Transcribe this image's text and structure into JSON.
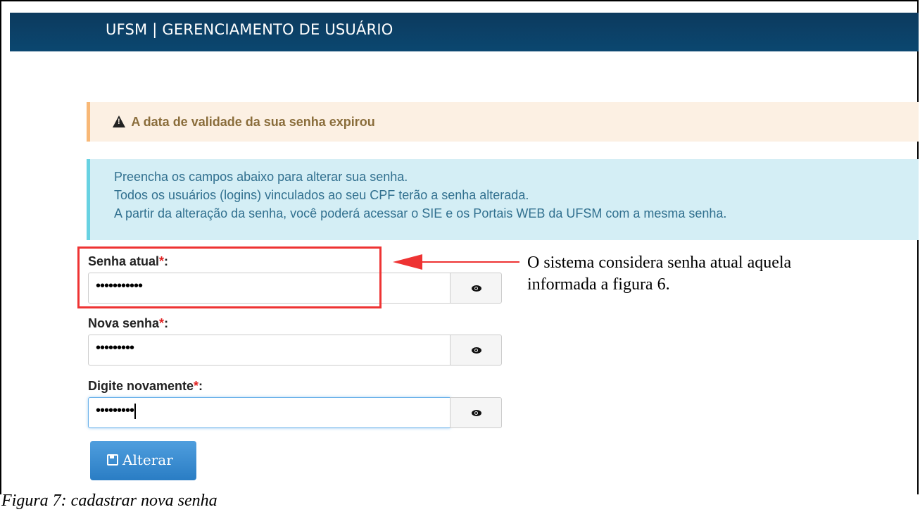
{
  "header": {
    "title": "UFSM | GERENCIAMENTO DE USUÁRIO"
  },
  "alerts": {
    "warning": "A data de validade da sua senha expirou",
    "info_lines": [
      "Preencha os campos abaixo para alterar sua senha.",
      "Todos os usuários (logins) vinculados ao seu CPF terão a senha alterada.",
      "A partir da alteração da senha, você poderá acessar o SIE e os Portais WEB da UFSM com a mesma senha."
    ]
  },
  "form": {
    "fields": [
      {
        "label": "Senha atual",
        "required_mark": "*",
        "suffix": ":",
        "value": "•••••••••••"
      },
      {
        "label": "Nova senha",
        "required_mark": "*",
        "suffix": ":",
        "value": "•••••••••"
      },
      {
        "label": "Digite novamente",
        "required_mark": "*",
        "suffix": ":",
        "value": "•••••••••"
      }
    ],
    "submit_label": "Alterar"
  },
  "annotation": {
    "lines": [
      "O sistema considera senha atual aquela",
      "informada a figura 6."
    ]
  },
  "caption": "Figura 7: cadastrar nova senha",
  "colors": {
    "header_bg": "#0b4770",
    "warning_border": "#f8b877",
    "info_border": "#68d2e2",
    "highlight": "#ee3333",
    "button": "#2a7dc4"
  }
}
